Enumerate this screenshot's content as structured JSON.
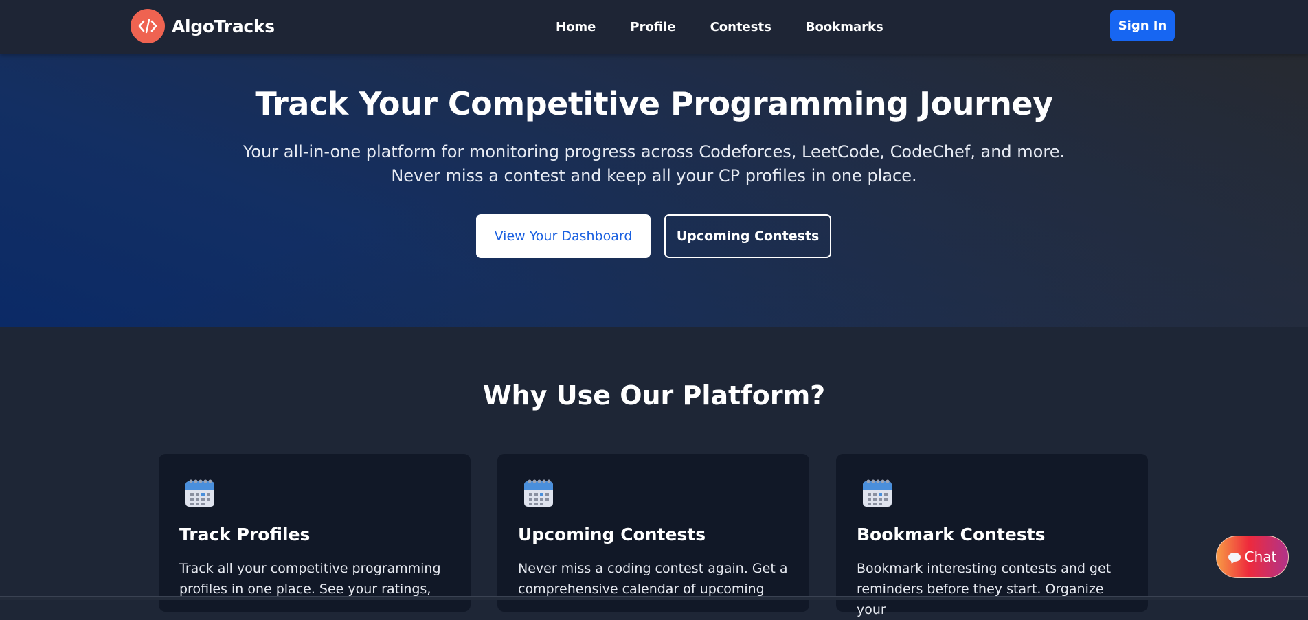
{
  "navbar": {
    "brand": "AlgoTracks",
    "links": [
      "Home",
      "Profile",
      "Contests",
      "Bookmarks"
    ],
    "signin_label": "Sign In"
  },
  "hero": {
    "title": "Track Your Competitive Programming Journey",
    "subtitle_line1": "Your all-in-one platform for monitoring progress across Codeforces, LeetCode, CodeChef, and more.",
    "subtitle_line2": "Never miss a contest and keep all your CP profiles in one place.",
    "primary_button": "View Your Dashboard",
    "secondary_button": "Upcoming Contests"
  },
  "features": {
    "title": "Why Use Our Platform?",
    "cards": [
      {
        "icon": "calendar-icon",
        "title": "Track Profiles",
        "description": "Track all your competitive programming profiles in one place. See your ratings,"
      },
      {
        "icon": "calendar-icon",
        "title": "Upcoming Contests",
        "description": "Never miss a coding contest again. Get a comprehensive calendar of upcoming"
      },
      {
        "icon": "calendar-icon",
        "title": "Bookmark Contests",
        "description": "Bookmark interesting contests and get reminders before they start. Organize your"
      }
    ]
  },
  "chat": {
    "label": "Chat",
    "icon": "speech-bubble-icon"
  },
  "colors": {
    "accent": "#1766f2",
    "logo": "#ef6351",
    "card_bg": "#111827",
    "page_bg": "#1e2636"
  }
}
